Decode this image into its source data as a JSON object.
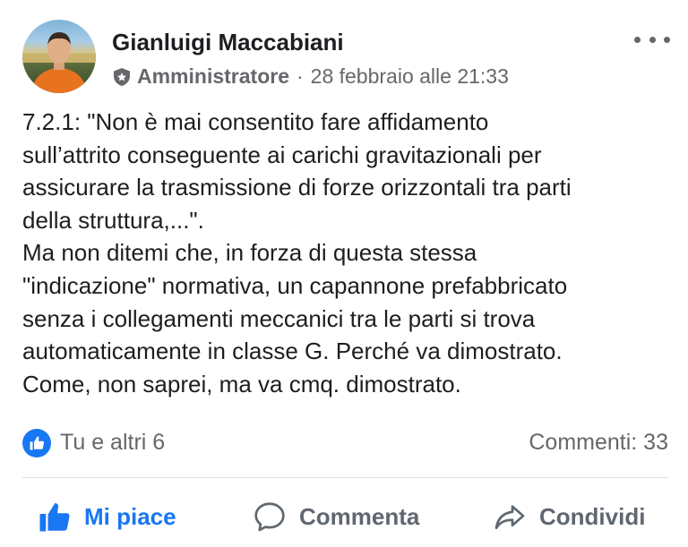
{
  "post": {
    "author": "Gianluigi Maccabiani",
    "role": "Amministratore",
    "separator": "·",
    "timestamp": "28 febbraio alle 21:33",
    "lines": [
      "7.2.1: \"Non è mai consentito fare affidamento",
      "sull’attrito conseguente ai carichi gravitazionali per",
      "assicurare la trasmissione di forze orizzontali tra parti",
      "della struttura,...\".",
      "Ma non ditemi che, in forza di questa stessa",
      "\"indicazione\" normativa, un capannone prefabbricato",
      "senza i collegamenti meccanici tra le parti si trova",
      "automaticamente in classe G. Perché va dimostrato.",
      "Come, non saprei, ma va cmq. dimostrato."
    ]
  },
  "stats": {
    "likes": "Tu e altri 6",
    "comments": "Commenti: 33"
  },
  "actions": {
    "like": "Mi piace",
    "comment": "Commenta",
    "share": "Condividi"
  },
  "icons": {
    "more": "more-options-icon",
    "role": "admin-shield-icon",
    "like_badge": "thumbs-up-icon",
    "like": "thumbs-up-icon",
    "comment": "speech-bubble-icon",
    "share": "share-arrow-icon"
  },
  "colors": {
    "accent": "#1877f2",
    "secondary_text": "#65676b",
    "action_text": "#606770",
    "divider": "#dadde1"
  }
}
